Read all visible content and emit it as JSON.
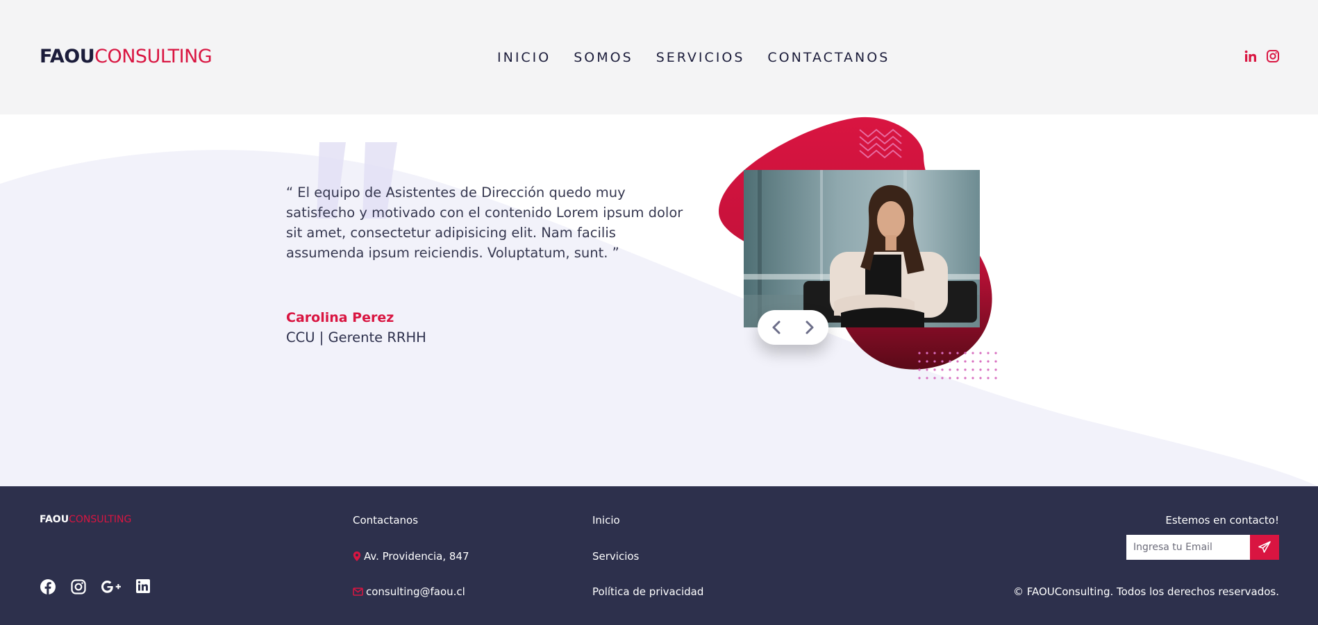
{
  "header": {
    "logo_part1": "FAOU",
    "logo_part2": "CONSULTING",
    "nav": [
      "INICIO",
      "SOMOS",
      "SERVICIOS",
      "CONTACTANOS"
    ],
    "social_icons": [
      "linkedin-icon",
      "instagram-icon"
    ]
  },
  "testimonial": {
    "quote": "“ El equipo de Asistentes de Dirección quedo muy satisfecho y motivado con el contenido Lorem ipsum dolor sit amet, consectetur adipisicing elit. Nam facilis assumenda ipsum reiciendis. Voluptatum, sunt. ”",
    "name": "Carolina Perez",
    "role": "CCU | Gerente RRHH",
    "prev_icon": "chevron-left-icon",
    "next_icon": "chevron-right-icon"
  },
  "footer": {
    "logo_part1": "FAOU",
    "logo_part2": "CONSULTING",
    "social_icons": [
      "facebook-icon",
      "instagram-icon",
      "google-plus-icon",
      "linkedin-icon"
    ],
    "contact_title": "Contactanos",
    "address": "Av. Providencia, 847",
    "email": "consulting@faou.cl",
    "links": [
      "Inicio",
      "Servicios",
      "Política de privacidad"
    ],
    "newsletter_title": "Estemos en contacto!",
    "email_placeholder": "Ingresa tu Email",
    "send_icon": "paper-plane-icon",
    "copyright": "© FAOUConsulting. Todos los derechos reservados."
  },
  "colors": {
    "brand_red": "#d91541",
    "navy": "#2d304c",
    "header_bg": "#f4f4f5",
    "wave_bg": "#f2f2fa"
  }
}
